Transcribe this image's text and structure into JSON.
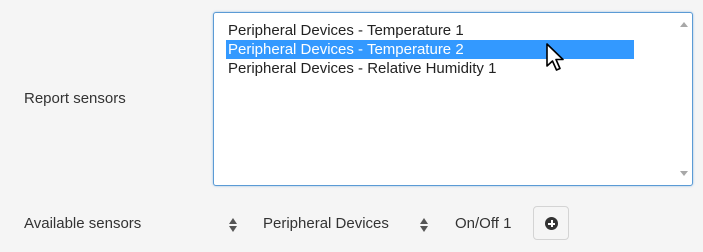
{
  "report_sensors": {
    "label": "Report sensors",
    "items": [
      {
        "label": "Peripheral Devices - Temperature 1",
        "selected": false
      },
      {
        "label": "Peripheral Devices - Temperature 2",
        "selected": true
      },
      {
        "label": "Peripheral Devices - Relative Humidity 1",
        "selected": false
      }
    ]
  },
  "available_sensors": {
    "label": "Available sensors",
    "device_select": "Peripheral Devices",
    "sensor_select": "On/Off 1",
    "add_icon": "plus-circle-icon"
  },
  "colors": {
    "selection": "#3399ff",
    "focus_border": "#5b9bd5",
    "background": "#f5f5f5"
  }
}
